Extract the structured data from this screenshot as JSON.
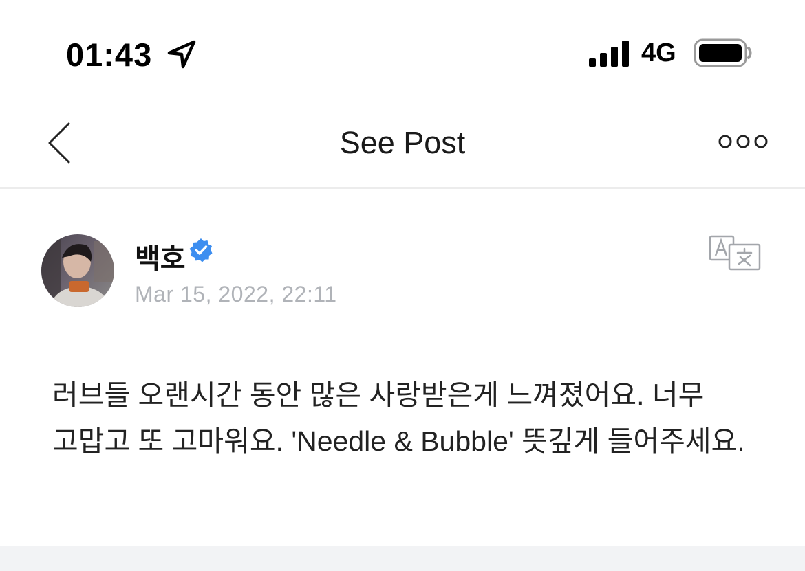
{
  "status_bar": {
    "time": "01:43",
    "network": "4G"
  },
  "nav": {
    "title": "See Post"
  },
  "post": {
    "author": "백호",
    "date": "Mar 15, 2022, 22:11",
    "body": "러브들 오랜시간 동안 많은 사랑받은게 느껴졌어요. 너무 고맙고 또 고마워요. 'Needle & Bubble' 뜻깊게 들어주세요."
  },
  "icons": {
    "location": "location-arrow-icon",
    "signal": "cellular-signal-icon",
    "battery": "battery-icon",
    "back": "chevron-left-icon",
    "more": "more-icon",
    "verified": "verified-badge-icon",
    "translate": "translate-icon"
  },
  "colors": {
    "verified": "#3d8ef0",
    "date_text": "#b0b3b8",
    "divider": "#ececec"
  }
}
